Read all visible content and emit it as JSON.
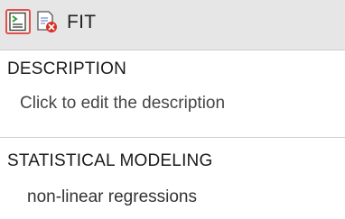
{
  "header": {
    "title": "FIT",
    "report_icon": "report-icon",
    "delete_icon": "delete-report-icon"
  },
  "description": {
    "heading": "DESCRIPTION",
    "value": "Click to edit the description"
  },
  "statistical_modeling": {
    "heading": "STATISTICAL MODELING",
    "value": "non-linear regressions"
  },
  "colors": {
    "header_bg": "#e6e6e6",
    "selected_border": "#e15050",
    "delete_red": "#d93025"
  }
}
